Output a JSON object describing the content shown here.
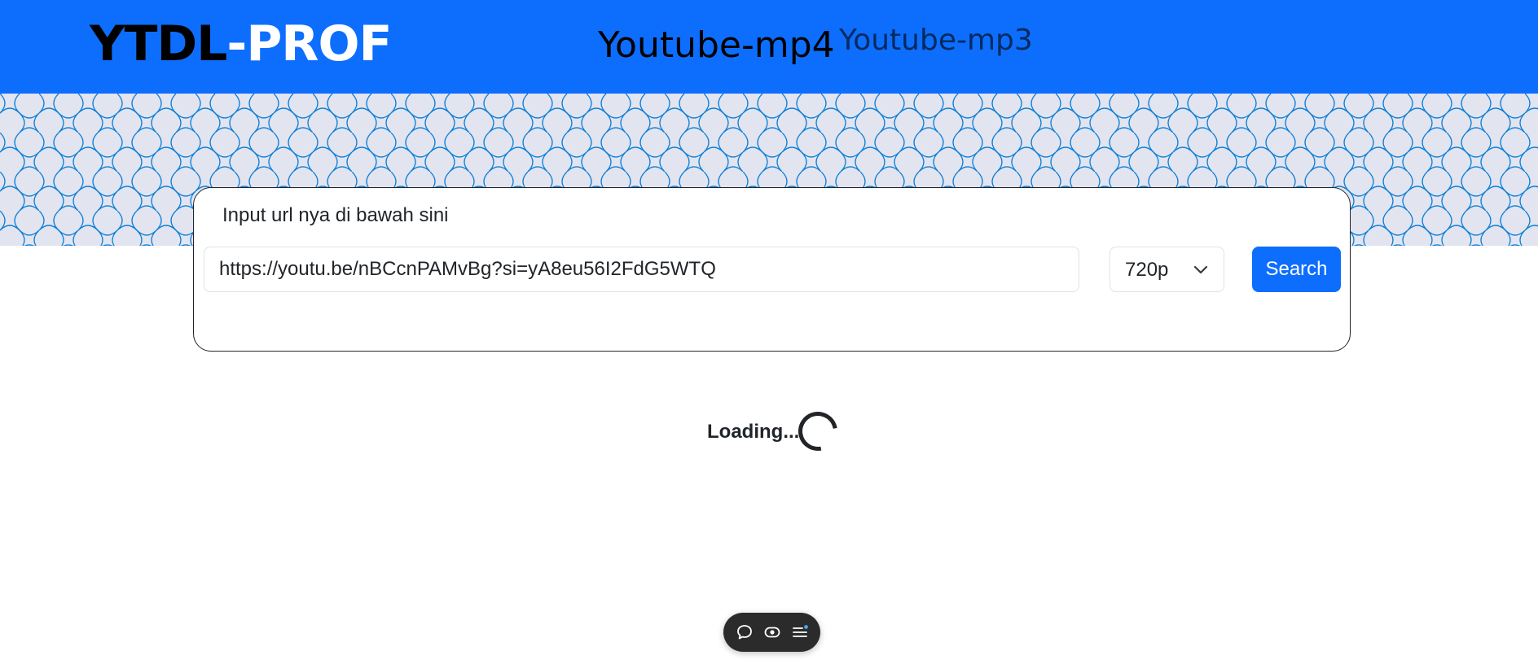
{
  "navbar": {
    "brand_part1": "YTDL",
    "brand_part2": "-PROF",
    "nav_mp4": "Youtube-mp4",
    "nav_mp3": "Youtube-mp3"
  },
  "colors": {
    "primary": "#0d6efd",
    "pattern_bg": "#e2e4ef",
    "pattern_line": "#0d7fd8"
  },
  "form": {
    "label": "Input url nya di bawah sini",
    "url_value": "https://youtu.be/nBCcnPAMvBg?si=yA8eu56I2FdG5WTQ",
    "resolution_selected": "720p",
    "search_label": "Search"
  },
  "status": {
    "loading_text": "Loading..."
  },
  "toolbar": {
    "icons": [
      "chat-icon",
      "eye-icon",
      "menu-icon"
    ]
  }
}
